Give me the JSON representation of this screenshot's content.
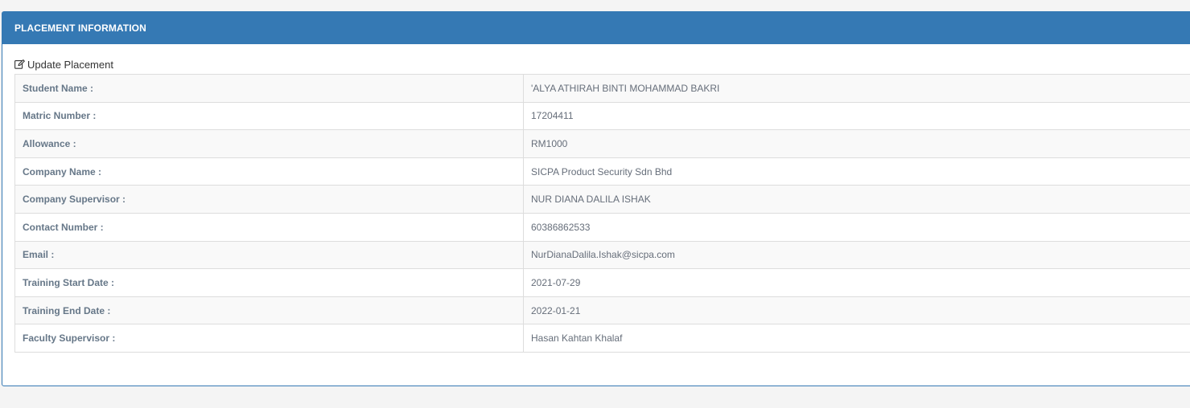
{
  "panel": {
    "title": "PLACEMENT INFORMATION",
    "update_link": "Update Placement",
    "update_icon": "edit-icon"
  },
  "fields": [
    {
      "label": "Student Name :",
      "value": "'ALYA ATHIRAH BINTI MOHAMMAD BAKRI"
    },
    {
      "label": "Matric Number :",
      "value": "17204411"
    },
    {
      "label": "Allowance :",
      "value": "RM1000"
    },
    {
      "label": "Company Name :",
      "value": "SICPA Product Security Sdn Bhd"
    },
    {
      "label": "Company Supervisor :",
      "value": "NUR DIANA DALILA ISHAK"
    },
    {
      "label": "Contact Number :",
      "value": "60386862533"
    },
    {
      "label": "Email :",
      "value": "NurDianaDalila.Ishak@sicpa.com"
    },
    {
      "label": "Training Start Date :",
      "value": "2021-07-29"
    },
    {
      "label": "Training End Date :",
      "value": "2022-01-21"
    },
    {
      "label": "Faculty Supervisor :",
      "value": "Hasan Kahtan Khalaf"
    }
  ],
  "colors": {
    "header_bg": "#3579b4",
    "label_text": "#667788",
    "value_text": "#666e7a"
  }
}
